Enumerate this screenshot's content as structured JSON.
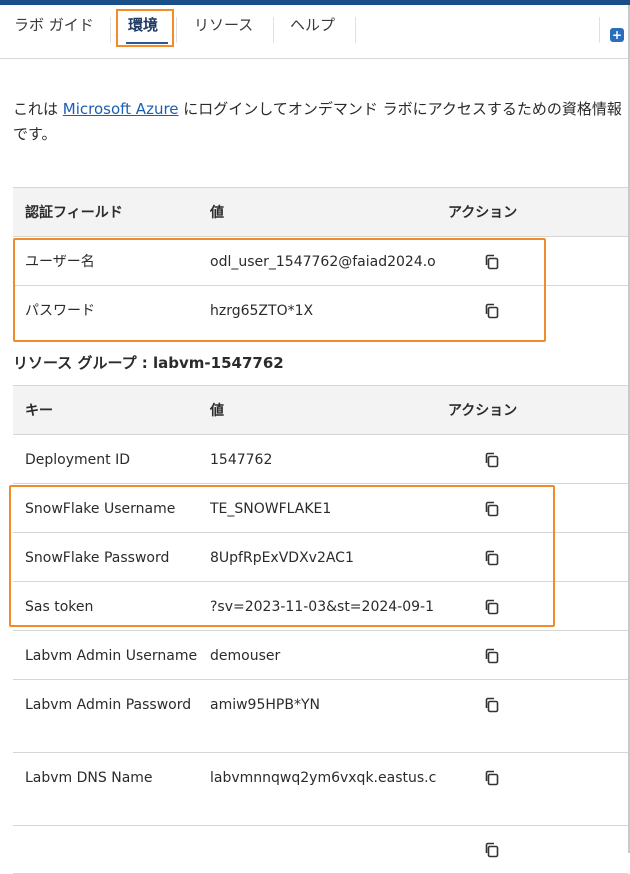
{
  "tabs": [
    {
      "label": "ラボ ガイド"
    },
    {
      "label": "環境"
    },
    {
      "label": "リソース"
    },
    {
      "label": "ヘルプ"
    }
  ],
  "intro": {
    "before": "これは ",
    "link": "Microsoft Azure",
    "after": " にログインしてオンデマンド ラボにアクセスするための資格情報です。"
  },
  "credentials": {
    "headers": [
      "認証フィールド",
      "値",
      "アクション"
    ],
    "rows": [
      {
        "key": "ユーザー名",
        "value": "odl_user_1547762@faiad2024.o"
      },
      {
        "key": "パスワード",
        "value": "hzrg65ZTO*1X"
      }
    ]
  },
  "resource_group": {
    "title": "リソース グループ : labvm-1547762",
    "headers": [
      "キー",
      "値",
      "アクション"
    ],
    "rows": [
      {
        "key": "Deployment ID",
        "value": "1547762"
      },
      {
        "key": "SnowFlake Username",
        "value": "TE_SNOWFLAKE1"
      },
      {
        "key": "SnowFlake Password",
        "value": "8UpfRpExVDXv2AC1"
      },
      {
        "key": "Sas token",
        "value": "?sv=2023-11-03&st=2024-09-1"
      },
      {
        "key": "Labvm Admin Username",
        "value": "demouser"
      },
      {
        "key": "Labvm Admin Password",
        "value": "amiw95HPB*YN"
      },
      {
        "key": "Labvm DNS Name",
        "value": "labvmnnqwq2ym6vxqk.eastus.c"
      }
    ]
  },
  "icons": {
    "copy": "copy-icon",
    "add": "plus-icon"
  },
  "colors": {
    "accent": "#f28c28",
    "link": "#1a5fb4",
    "brand": "#1b4f8a"
  }
}
